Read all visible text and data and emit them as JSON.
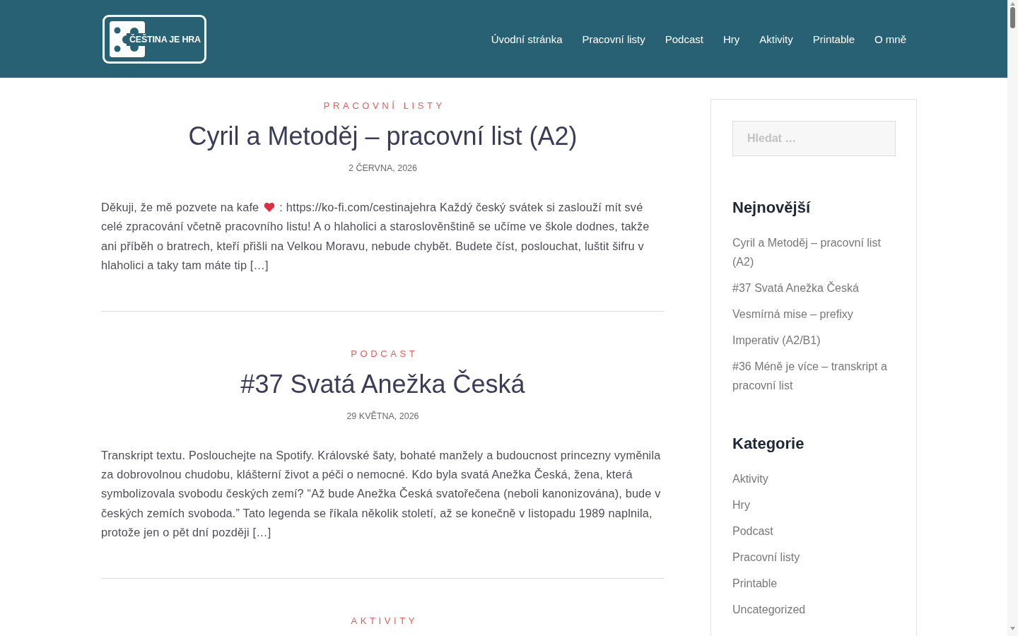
{
  "header": {
    "logo_text": "ČEŠTINA JE HRA",
    "nav": [
      "Úvodní stránka",
      "Pracovní listy",
      "Podcast",
      "Hry",
      "Aktivity",
      "Printable",
      "O mně"
    ]
  },
  "posts": [
    {
      "category": "PRACOVNÍ LISTY",
      "title": "Cyril a Metoděj – pracovní list (A2)",
      "date": "2 ČERVNA, 2026",
      "excerpt": [
        {
          "kind": "text",
          "text": "Děkuji, že mě pozvete na kafe"
        },
        {
          "kind": "heart"
        },
        {
          "kind": "text",
          "text": ": https://ko-fi.com/cestinajehra Každý český svátek si zaslouží mít své celé zpracování včetně pracovního listu! A o hlaholici a staroslověnštině se učíme ve škole dodnes, takže ani příběh o bratrech, kteří přišli na Velkou Moravu, nebude chybět. Budete číst, poslouchat, luštit šifru v hlaholici a taky tam máte tip […]"
        }
      ]
    },
    {
      "category": "PODCAST",
      "title": "#37 Svatá Anežka Česká",
      "date": "29 KVĚTNA, 2026",
      "excerpt": [
        {
          "kind": "text",
          "text": "Transkript textu. Poslouchejte na Spotify. Královské šaty, bohaté manžely a budoucnost princezny vyměnila za dobrovolnou chudobu, klášterní život a péči o nemocné. Kdo byla svatá Anežka Česká, žena, která symbolizovala svobodu českých zemí? “Až bude Anežka Česká svatořečena (neboli kanonizována), bude v českých zemích svoboda.” Tato legenda se říkala několik století, až se konečně v listopadu 1989 naplnila, protože jen o pět dní později […]"
        }
      ]
    },
    {
      "category": "AKTIVITY"
    }
  ],
  "sidebar": {
    "search": {
      "placeholder": "Hledat …"
    },
    "widgets": [
      {
        "heading": "Nejnovější",
        "items": [
          "Cyril a Metoděj – pracovní list (A2)",
          "#37 Svatá Anežka Česká",
          "Vesmírná mise – prefixy",
          "Imperativ (A2/B1)",
          "#36 Méně je více – transkript a pracovní list"
        ]
      },
      {
        "heading": "Kategorie",
        "items": [
          "Aktivity",
          "Hry",
          "Podcast",
          "Pracovní listy",
          "Printable",
          "Uncategorized"
        ]
      }
    ]
  }
}
